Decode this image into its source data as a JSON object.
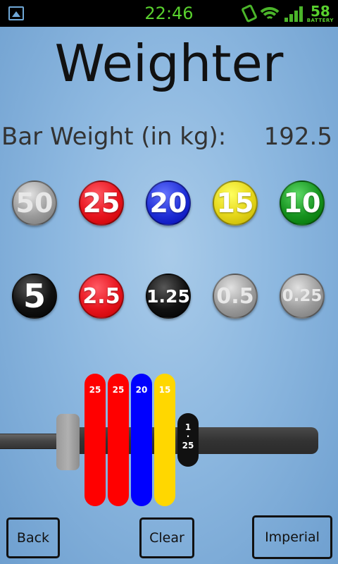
{
  "status_bar": {
    "time": "22:46",
    "battery_percent": "58",
    "battery_label": "BATTERY",
    "icons": [
      "picture-icon",
      "vibrate-icon",
      "wifi-icon",
      "signal-icon",
      "battery-icon"
    ]
  },
  "app": {
    "title": "Weighter",
    "bar_weight_label": "Bar Weight (in kg):",
    "bar_weight_value": "192.5"
  },
  "plates": [
    {
      "label": "50",
      "color": "#9b9b9b",
      "enabled": false
    },
    {
      "label": "25",
      "color": "#e8141e",
      "enabled": true
    },
    {
      "label": "20",
      "color": "#1f2ed6",
      "enabled": true
    },
    {
      "label": "15",
      "color": "#e5d619",
      "enabled": true
    },
    {
      "label": "10",
      "color": "#16931f",
      "enabled": true
    },
    {
      "label": "5",
      "color": "#111111",
      "enabled": true
    },
    {
      "label": "2.5",
      "color": "#e8141e",
      "enabled": true
    },
    {
      "label": "1.25",
      "color": "#111111",
      "enabled": true
    },
    {
      "label": "0.5",
      "color": "#9b9b9b",
      "enabled": false
    },
    {
      "label": "0.25",
      "color": "#9b9b9b",
      "enabled": false
    }
  ],
  "loaded_plates": [
    {
      "label": "25",
      "color": "#ff0000"
    },
    {
      "label": "25",
      "color": "#ff0000"
    },
    {
      "label": "20",
      "color": "#0000ff"
    },
    {
      "label": "15",
      "color": "#ffd700"
    }
  ],
  "loaded_small_plate": {
    "line1": "1",
    "line2": "·",
    "line3": "25",
    "color": "#111111"
  },
  "buttons": {
    "back": "Back",
    "clear": "Clear",
    "imperial": "Imperial"
  }
}
